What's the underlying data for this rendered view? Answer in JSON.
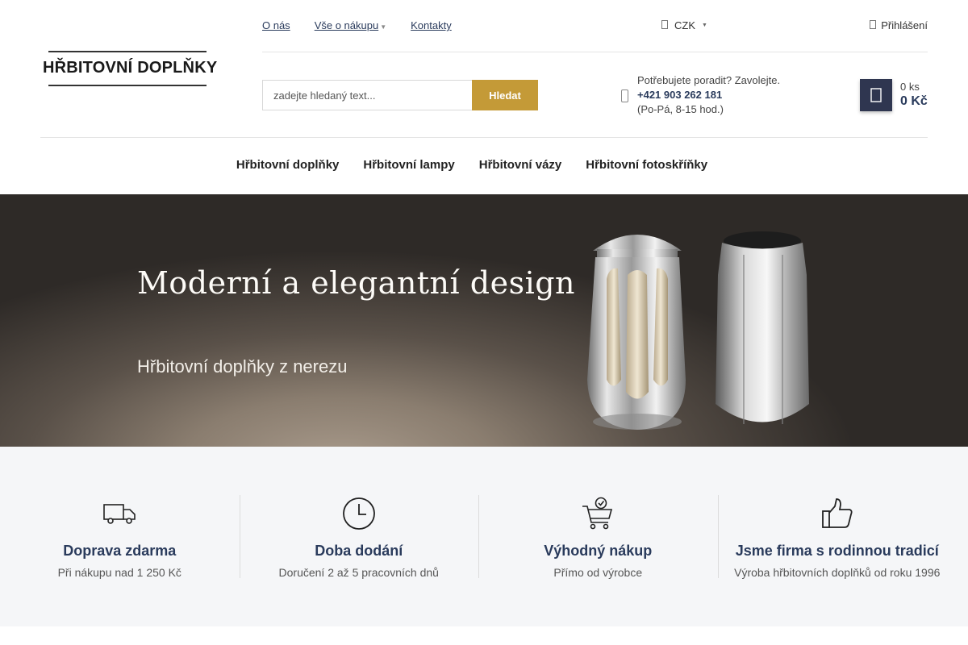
{
  "logo": {
    "text": "HŘBITOVNÍ DOPLŇKY"
  },
  "topnav": {
    "items": [
      {
        "label": "O nás"
      },
      {
        "label": "Vše o nákupu",
        "has_dropdown": true
      },
      {
        "label": "Kontakty"
      }
    ]
  },
  "currency": {
    "icon": "currency-icon",
    "label": "CZK"
  },
  "login": {
    "icon": "user-icon",
    "label": "Přihlášení"
  },
  "search": {
    "placeholder": "zadejte hledaný text...",
    "button_label": "Hledat"
  },
  "phone": {
    "icon": "phone-icon",
    "lead": "Potřebujete poradit? Zavolejte.",
    "number": "+421 903 262 181",
    "hours": "(Po-Pá, 8-15 hod.)"
  },
  "cart": {
    "icon": "cart-icon",
    "count": "0 ks",
    "price": "0 Kč"
  },
  "mainnav": {
    "items": [
      {
        "label": "Hřbitovní doplňky"
      },
      {
        "label": "Hřbitovní lampy"
      },
      {
        "label": "Hřbitovní vázy"
      },
      {
        "label": "Hřbitovní fotoskříňky"
      }
    ]
  },
  "hero": {
    "title": "Moderní a elegantní design",
    "subtitle": "Hřbitovní doplňky z nerezu"
  },
  "features": [
    {
      "icon": "truck-icon",
      "title": "Doprava zdarma",
      "desc": "Při nákupu nad 1 250 Kč"
    },
    {
      "icon": "clock-icon",
      "title": "Doba dodání",
      "desc": "Doručení 2 až 5 pracovních dnů"
    },
    {
      "icon": "cart-check-icon",
      "title": "Výhodný nákup",
      "desc": "Přímo od výrobce"
    },
    {
      "icon": "thumbs-up-icon",
      "title": "Jsme firma s rodinnou tradicí",
      "desc": "Výroba hřbitovních doplňků od roku 1996"
    }
  ],
  "colors": {
    "accent": "#c49a37",
    "primary": "#2a3b5c",
    "cart_button": "#2f3650",
    "features_bg": "#f5f6f8"
  }
}
